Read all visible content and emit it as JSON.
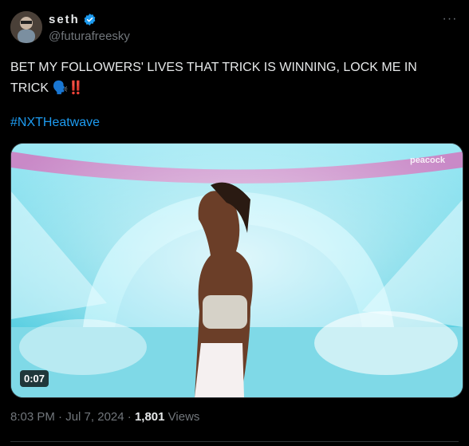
{
  "author": {
    "display_name": "seth",
    "handle": "@futurafreesky",
    "verified": true
  },
  "more_icon": "more-horizontal-icon",
  "tweet": {
    "text": "BET MY FOLLOWERS' LIVES THAT TRICK IS WINNING, LOCK ME IN TRICK",
    "emoji": "🗣️‼️",
    "hashtag": "#NXTHeatwave"
  },
  "media": {
    "duration": "0:07",
    "watermark": "peacock"
  },
  "meta": {
    "time": "8:03 PM",
    "sep1": " · ",
    "date": "Jul 7, 2024",
    "sep2": " · ",
    "views_count": "1,801",
    "views_label": " Views"
  },
  "colors": {
    "background": "#000000",
    "text": "#e7e9ea",
    "muted": "#71767b",
    "link": "#1d9bf0",
    "verified": "#1d9bf0"
  }
}
